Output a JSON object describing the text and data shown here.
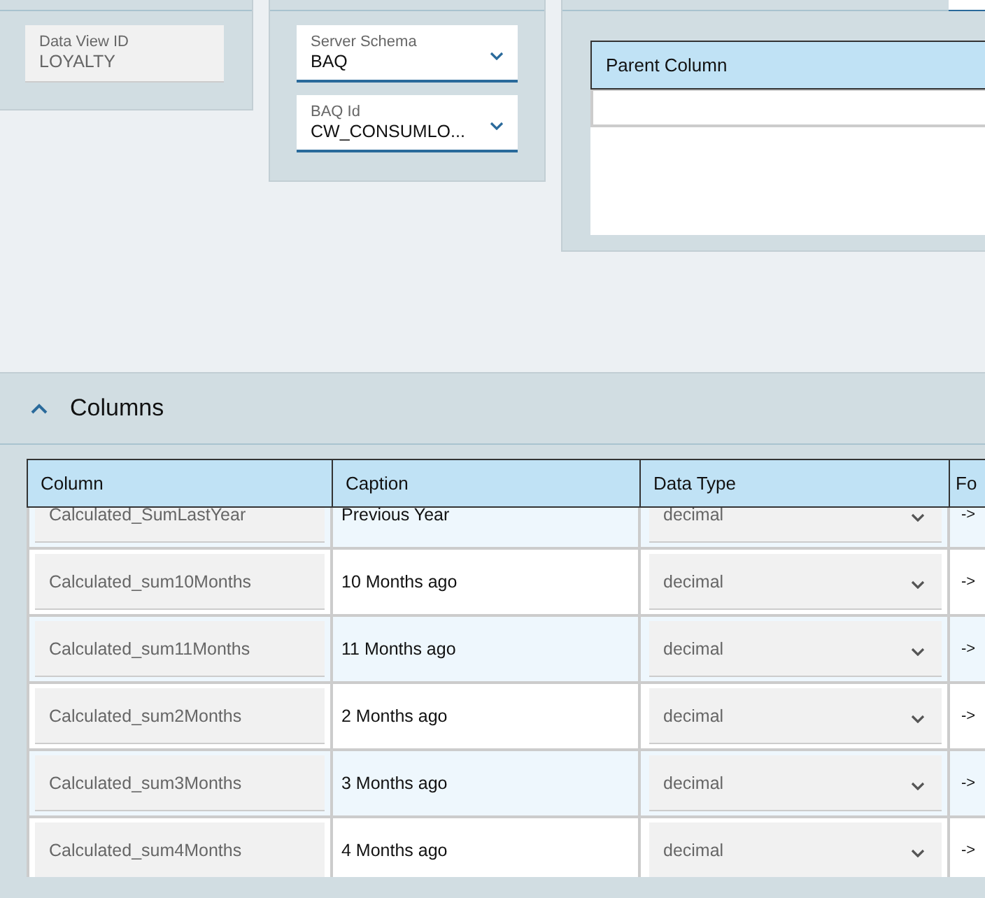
{
  "cards": [
    {
      "fields": [
        {
          "kind": "readonly",
          "label": "Data View ID",
          "value": "LOYALTY"
        }
      ]
    },
    {
      "fields": [
        {
          "kind": "dropdown",
          "label": "Server Schema",
          "value": "BAQ"
        },
        {
          "kind": "dropdown",
          "label": "BAQ Id",
          "value": "CW_CONSUMLO..."
        }
      ]
    }
  ],
  "parent_grid": {
    "columns": [
      "Parent Column"
    ]
  },
  "columns_panel": {
    "title": "Columns",
    "expanded": true,
    "columns": [
      "Column",
      "Caption",
      "Data Type",
      "Fo"
    ],
    "rows": [
      {
        "column": "Calculated_SumLastYear",
        "caption": "Previous Year",
        "data_type": "decimal",
        "column_4": "->"
      },
      {
        "column": "Calculated_sum10Months",
        "caption": "10 Months ago",
        "data_type": "decimal",
        "column_4": "->"
      },
      {
        "column": "Calculated_sum11Months",
        "caption": "11 Months ago",
        "data_type": "decimal",
        "column_4": "->"
      },
      {
        "column": "Calculated_sum2Months",
        "caption": "2 Months ago",
        "data_type": "decimal",
        "column_4": "->"
      },
      {
        "column": "Calculated_sum3Months",
        "caption": "3 Months ago",
        "data_type": "decimal",
        "column_4": "->"
      },
      {
        "column": "Calculated_sum4Months",
        "caption": "4 Months ago",
        "data_type": "decimal",
        "column_4": "->"
      }
    ]
  }
}
